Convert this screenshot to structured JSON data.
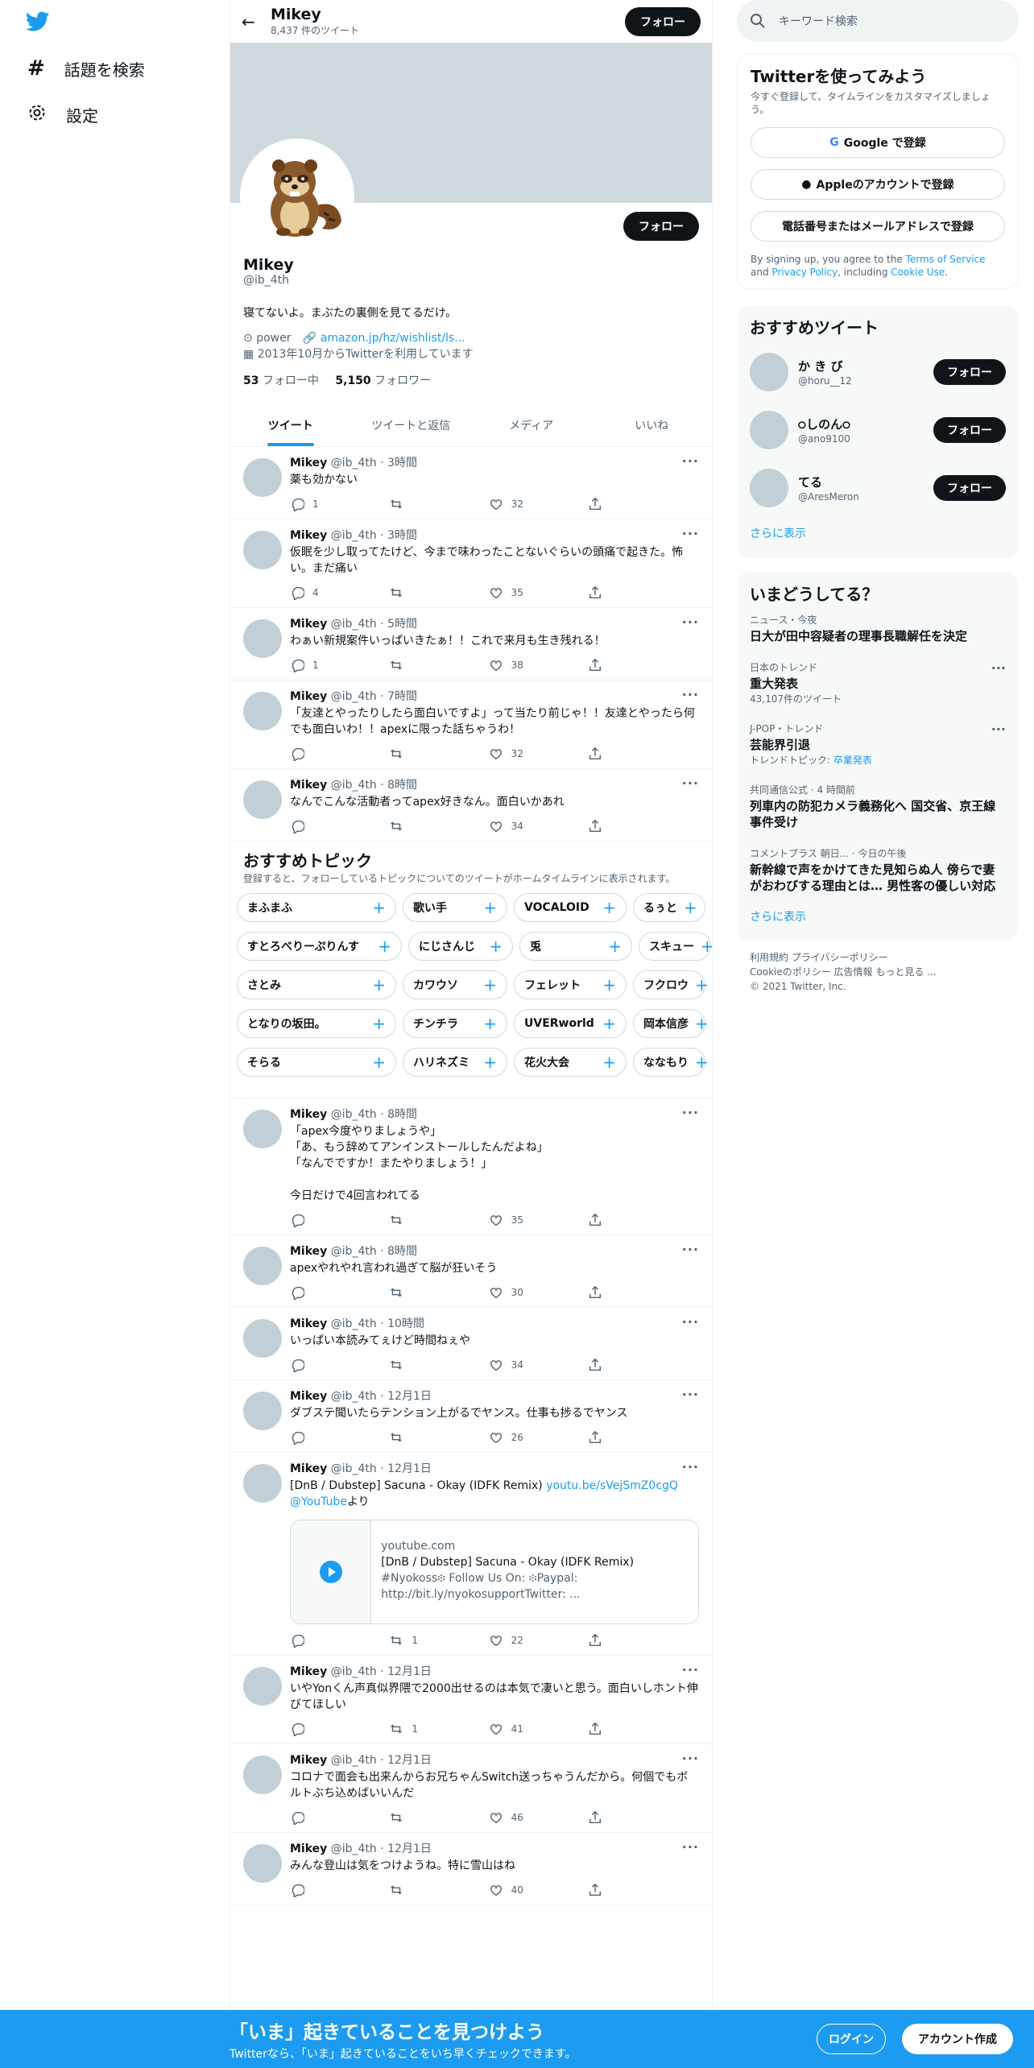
{
  "nav": {
    "explore": "話題を検索",
    "settings": "設定"
  },
  "header": {
    "name": "Mikey",
    "tweet_count": "8,437 件のツイート",
    "follow": "フォロー"
  },
  "profile": {
    "name": "Mikey",
    "handle": "@ib_4th",
    "follow": "フォロー",
    "bio": "寝てないよ。まぶたの裏側を見てるだけ。",
    "location": "power",
    "link": "amazon.jp/hz/wishlist/ls...",
    "joined": "2013年10月からTwitterを利用しています",
    "following_num": "53",
    "following_label": "フォロー中",
    "followers_num": "5,150",
    "followers_label": "フォロワー"
  },
  "tabs": [
    "ツイート",
    "ツイートと返信",
    "メディア",
    "いいね"
  ],
  "tweets": [
    {
      "name": "Mikey",
      "meta": "@ib_4th · 3時間",
      "text": "薬も効かない",
      "reply": "1",
      "rt": "",
      "like": "32"
    },
    {
      "name": "Mikey",
      "meta": "@ib_4th · 3時間",
      "text": "仮眠を少し取ってたけど、今まで味わったことないぐらいの頭痛で起きた。怖い。まだ痛い",
      "reply": "4",
      "rt": "",
      "like": "35"
    },
    {
      "name": "Mikey",
      "meta": "@ib_4th · 5時間",
      "text": "わぁい新規案件いっぱいきたぁ！！これで来月も生き残れる！",
      "reply": "1",
      "rt": "",
      "like": "38"
    },
    {
      "name": "Mikey",
      "meta": "@ib_4th · 7時間",
      "text": "「友達とやったりしたら面白いですよ」って当たり前じゃ！！友達とやったら何でも面白いわ！！apexに限った話ちゃうわ！",
      "reply": "",
      "rt": "",
      "like": "32"
    },
    {
      "name": "Mikey",
      "meta": "@ib_4th · 8時間",
      "text": "なんでこんな活動者ってapex好きなん。面白いかあれ",
      "reply": "",
      "rt": "",
      "like": "34"
    },
    {
      "name": "Mikey",
      "meta": "@ib_4th · 8時間",
      "text": "「apex今度やりましょうや」\n「あ、もう辞めてアンインストールしたんだよね」\n「なんでですか！またやりましょう！」\n\n今日だけで4回言われてる",
      "reply": "",
      "rt": "",
      "like": "35"
    },
    {
      "name": "Mikey",
      "meta": "@ib_4th · 8時間",
      "text": "apexやれやれ言われ過ぎて脳が狂いそう",
      "reply": "",
      "rt": "",
      "like": "30"
    },
    {
      "name": "Mikey",
      "meta": "@ib_4th · 10時間",
      "text": "いっぱい本読みてぇけど時間ねぇや",
      "reply": "",
      "rt": "",
      "like": "34"
    },
    {
      "name": "Mikey",
      "meta": "@ib_4th · 12月1日",
      "text": "ダブステ聞いたらテンション上がるでヤンス。仕事も捗るでヤンス",
      "reply": "",
      "rt": "",
      "like": "26"
    },
    {
      "name": "Mikey",
      "meta": "@ib_4th · 12月1日",
      "text": "[DnB / Dubstep] Sacuna - Okay (IDFK Remix) ",
      "link1": "youtu.be/sVejSmZ0cgQ",
      "link2": "@YouTube",
      "text2": "より",
      "card_domain": "youtube.com",
      "card_title": "[DnB / Dubstep] Sacuna - Okay (IDFK Remix)",
      "card_desc": "#Nyokoss፨ Follow Us On: ፨Paypal: http://bit.ly/nyokosupportTwitter: ...",
      "reply": "",
      "rt": "1",
      "like": "22"
    },
    {
      "name": "Mikey",
      "meta": "@ib_4th · 12月1日",
      "text": "いやYonくん声真似界隈で2000出せるのは本気で凄いと思う。面白いしホント伸びてほしい",
      "reply": "",
      "rt": "1",
      "like": "41"
    },
    {
      "name": "Mikey",
      "meta": "@ib_4th · 12月1日",
      "text": "コロナで面会も出来んからお兄ちゃんSwitch送っちゃうんだから。何個でもボルトぶち込めばいいんだ",
      "reply": "",
      "rt": "",
      "like": "46"
    },
    {
      "name": "Mikey",
      "meta": "@ib_4th · 12月1日",
      "text": "みんな登山は気をつけようね。特に雪山はね",
      "reply": "",
      "rt": "",
      "like": "40"
    }
  ],
  "topics": {
    "title": "おすすめトピック",
    "desc": "登録すると、フォローしているトピックについてのツイートがホームタイムラインに表示されます。",
    "rows": [
      [
        "まふまふ",
        "歌い手",
        "VOCALOID",
        "るぅと"
      ],
      [
        "すとろべりーぷりんす",
        "にじさんじ",
        "兎",
        "スキュー"
      ],
      [
        "さとみ",
        "カワウソ",
        "フェレット",
        "フクロウ"
      ],
      [
        "となりの坂田。",
        "チンチラ",
        "UVERworld",
        "岡本信彦"
      ],
      [
        "そらる",
        "ハリネズミ",
        "花火大会",
        "ななもり"
      ]
    ]
  },
  "sidebar": {
    "search_placeholder": "キーワード検索",
    "signup_title": "Twitterを使ってみよう",
    "signup_desc": "今すぐ登録して、タイムラインをカスタマイズしましょう。",
    "google": "Google で登録",
    "apple": "Appleのアカウントで登録",
    "phone": "電話番号またはメールアドレスで登録",
    "terms_pre": "By signing up, you agree to the ",
    "terms": "Terms of Service",
    "terms_and": " and ",
    "privacy": "Privacy Policy",
    "terms_inc": ", including ",
    "cookie": "Cookie Use",
    "terms_end": ".",
    "rec_title": "おすすめツイート",
    "rec": [
      {
        "name": "か き び",
        "handle": "@horu__12"
      },
      {
        "name": "੦しのん੦",
        "handle": "@ano9100"
      },
      {
        "name": "てる",
        "handle": "@AresMeron"
      }
    ],
    "rec_follow": "フォロー",
    "show_more": "さらに表示",
    "trend_title": "いまどうしてる？",
    "trends": [
      {
        "cat": "ニュース・今夜",
        "head": "日大が田中容疑者の理事長職解任を決定",
        "sub": ""
      },
      {
        "cat": "日本のトレンド",
        "head": "重大発表",
        "sub": "43,107件のツイート"
      },
      {
        "cat": "J-POP・トレンド",
        "head": "芸能界引退",
        "sub": "トレンドトピック: ",
        "sublink": "卒業発表"
      },
      {
        "cat": "共同通信公式 · 4 時間前",
        "head": "列車内の防犯カメラ義務化へ 国交省、京王線事件受け",
        "sub": ""
      },
      {
        "cat": "コメントプラス 朝日... · 今日の午後",
        "head": "新幹線で声をかけてきた見知らぬ人 傍らで妻がおわびする理由とは… 男性客の優しい対応",
        "sub": ""
      }
    ],
    "trend_more": "さらに表示",
    "footer1": "利用規約 プライバシーポリシー",
    "footer2": "Cookieのポリシー 広告情報 もっと見る ...",
    "footer3": "© 2021 Twitter, Inc."
  },
  "bottom": {
    "title": "「いま」起きていることを見つけよう",
    "desc": "Twitterなら、「いま」起きていることをいち早くチェックできます。",
    "login": "ログイン",
    "signup": "アカウント作成"
  },
  "colors": {
    "accent": "#1d9bf0",
    "dark": "#0f1419",
    "muted": "#536471"
  }
}
